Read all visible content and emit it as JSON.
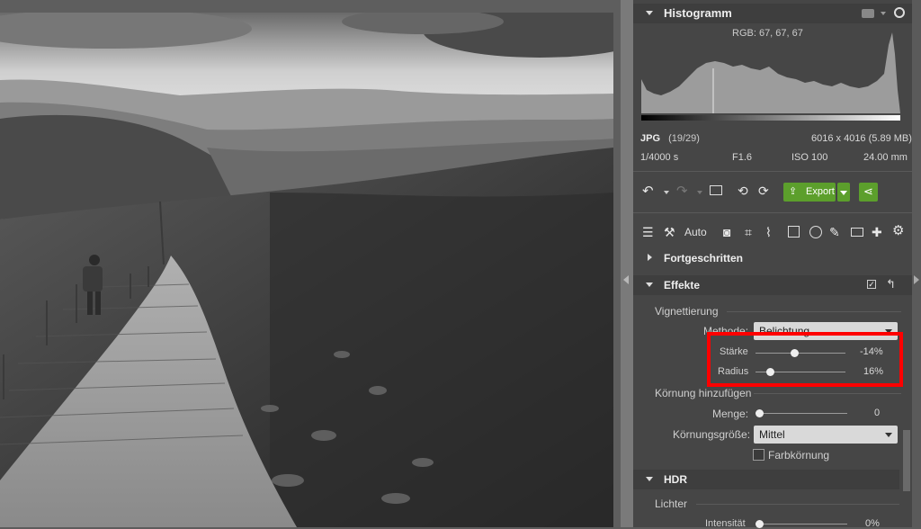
{
  "histogram": {
    "title": "Histogramm",
    "rgb_readout": "RGB: 67, 67, 67",
    "format": "JPG",
    "position": "(19/29)",
    "dimensions": "6016 x 4016 (5.89 MB)",
    "shutter": "1/4000 s",
    "aperture": "F1.6",
    "iso": "ISO 100",
    "focal": "24.00 mm"
  },
  "toolbar": {
    "export_label": "Export",
    "auto_label": "Auto"
  },
  "fortgeschritten": {
    "title": "Fortgeschritten"
  },
  "effekte": {
    "title": "Effekte",
    "vignettierung": {
      "label": "Vignettierung",
      "methode_label": "Methode:",
      "methode_value": "Belichtung",
      "staerke_label": "Stärke",
      "staerke_value": "-14%",
      "staerke_level": 0.43,
      "radius_label": "Radius",
      "radius_value": "16%",
      "radius_level": 0.16
    },
    "koernung": {
      "label": "Körnung hinzufügen",
      "menge_label": "Menge:",
      "menge_value": "0",
      "menge_level": 0.0,
      "groesse_label": "Körnungsgröße:",
      "groesse_value": "Mittel",
      "farb_label": "Farbkörnung"
    }
  },
  "hdr": {
    "title": "HDR",
    "lichter_label": "Lichter",
    "intensitaet_label": "Intensität",
    "intensitaet_value": "0%"
  }
}
